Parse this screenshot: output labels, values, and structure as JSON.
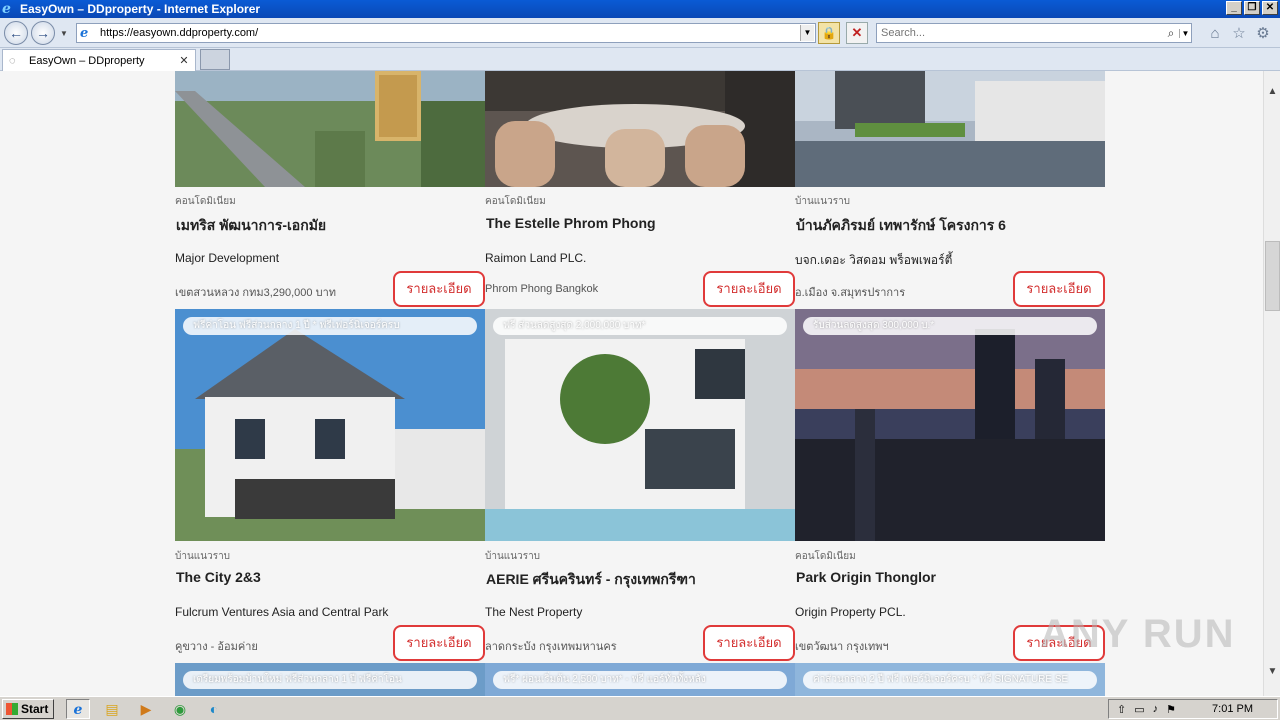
{
  "window": {
    "title": "EasyOwn – DDproperty - Internet Explorer",
    "minimize": "_",
    "restore": "❐",
    "close": "✕"
  },
  "nav": {
    "back": "←",
    "forward": "→",
    "url": "https://easyown.ddproperty.com/",
    "search_placeholder": "Search..."
  },
  "tab": {
    "label": "EasyOwn – DDproperty",
    "close": "✕"
  },
  "cards": [
    {
      "category": "คอนโดมิเนียม",
      "name": "เมทริส พัฒนาการ-เอกมัย",
      "developer": "Major Development",
      "location": "เขตสวนหลวง กทม3,290,000 บาท",
      "button": "รายละเอียด",
      "promo": ""
    },
    {
      "category": "คอนโดมิเนียม",
      "name": "The Estelle Phrom Phong",
      "developer": "Raimon Land PLC.",
      "location": "Phrom Phong Bangkok",
      "button": "รายละเอียด",
      "promo": ""
    },
    {
      "category": "บ้านแนวราบ",
      "name": "บ้านภัคภิรมย์ เทพารักษ์ โครงการ 6",
      "developer": "บจก.เดอะ วิสดอม พร็อพเพอร์ตี้",
      "location": "อ.เมือง จ.สมุทรปราการ",
      "button": "รายละเอียด",
      "promo": ""
    },
    {
      "category": "บ้านแนวราบ",
      "name": "The City 2&3",
      "developer": "Fulcrum Ventures Asia and Central Park",
      "location": "คูขวาง - อ้อมค่าย",
      "button": "รายละเอียด",
      "promo": "ฟรีค่าโอน ฟรีส่วนกลาง 1 ปี * ฟรีเฟอร์นิเจอร์ครบ"
    },
    {
      "category": "บ้านแนวราบ",
      "name": "AERIE ศรีนครินทร์ - กรุงเทพกรีฑา",
      "developer": "The Nest Property",
      "location": "ลาดกระบัง กรุงเทพมหานคร",
      "button": "รายละเอียด",
      "promo": "ฟรี ส่วนลดสูงสุด 2,000,000 บาท*"
    },
    {
      "category": "คอนโดมิเนียม",
      "name": "Park Origin Thonglor",
      "developer": "Origin Property PCL.",
      "location": "เขตวัฒนา กรุงเทพฯ",
      "button": "รายละเอียด",
      "promo": "รับส่วนลดสูงสุด 300,000 บ.*"
    },
    {
      "promo": "เตรียมพร้อมบ้านใหม่ ฟรีส่วนกลาง 1 ปี ฟรีค่าโอน"
    },
    {
      "promo": "ฟรี* ผ่อนเริ่มต้น 2,500 บาท* - ฟรี แอร์ทั่วทั้งหลัง"
    },
    {
      "promo": "ค่าส่วนกลาง 2 ปี ฟรี เฟอร์นิเจอร์ครบ * ฟรี SIGNATURE SE"
    }
  ],
  "taskbar": {
    "start": "Start",
    "time": "7:01 PM"
  },
  "watermark": "ANY RUN"
}
